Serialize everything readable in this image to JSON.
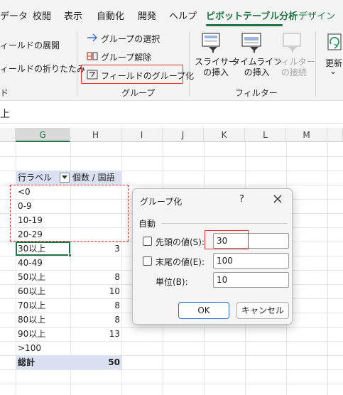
{
  "ribbon": {
    "tabs": [
      {
        "label": "データ"
      },
      {
        "label": "校閲"
      },
      {
        "label": "表示"
      },
      {
        "label": "自動化"
      },
      {
        "label": "開発"
      },
      {
        "label": "ヘルプ"
      },
      {
        "label": "ピボットテーブル分析"
      },
      {
        "label": "デザイン"
      }
    ],
    "field_expand": "ィールドの展開",
    "field_collapse": "ィールドの折りたたみ",
    "left_group_label": "ド",
    "group_selection": "グループの選択",
    "ungroup": "グループ解除",
    "group_field": "フィールドのグループ化",
    "group_section_label": "グループ",
    "slicer": "スライサー\nの挿入",
    "timeline": "タイムライン\nの挿入",
    "filter_connect": "フィルター\nの接続",
    "filter_section_label": "フィルター",
    "refresh": "更新",
    "refresh_arrow": "⌄",
    "accent_color": "#217346",
    "highlight_color": "#e03030"
  },
  "formula_bar": {
    "partial_text": "上"
  },
  "sheet": {
    "columns": [
      "G",
      "H",
      "I",
      "J",
      "K",
      "L",
      "M"
    ],
    "selected_column": "G",
    "pivot": {
      "row_label_header": "行ラベル",
      "value_header": "個数 / 国語",
      "rows": [
        {
          "label": "<0",
          "value": ""
        },
        {
          "label": "0-9",
          "value": ""
        },
        {
          "label": "10-19",
          "value": ""
        },
        {
          "label": "20-29",
          "value": ""
        },
        {
          "label": "30以上",
          "value": "3"
        },
        {
          "label": "40-49",
          "value": ""
        },
        {
          "label": "50以上",
          "value": "8"
        },
        {
          "label": "60以上",
          "value": "10"
        },
        {
          "label": "70以上",
          "value": "8"
        },
        {
          "label": "80以上",
          "value": "8"
        },
        {
          "label": "90以上",
          "value": "13"
        },
        {
          "label": ">100",
          "value": ""
        }
      ],
      "total_label": "総計",
      "total_value": "50"
    }
  },
  "dialog": {
    "title": "グループ化",
    "help": "?",
    "section": "自動",
    "start_label": "先頭の値(S):",
    "start_value": "30",
    "end_label": "末尾の値(E):",
    "end_value": "100",
    "unit_label": "単位(B):",
    "unit_value": "10",
    "ok": "OK",
    "cancel": "キャンセル"
  }
}
